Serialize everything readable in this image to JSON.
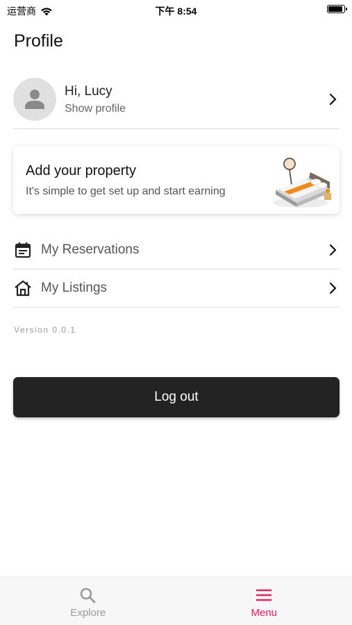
{
  "status_bar": {
    "carrier": "运营商",
    "time": "下午 8:54",
    "battery_level": 0.9
  },
  "page": {
    "title": "Profile"
  },
  "profile": {
    "greeting": "Hi, Lucy",
    "subtitle": "Show profile"
  },
  "promo": {
    "title": "Add your property",
    "subtitle": "It's simple to get set up and start earning"
  },
  "menu": [
    {
      "label": "My Reservations",
      "icon": "calendar-icon"
    },
    {
      "label": "My Listings",
      "icon": "house-icon"
    }
  ],
  "version": "Version 0.0.1",
  "logout": {
    "label": "Log out"
  },
  "tabs": [
    {
      "label": "Explore",
      "icon": "search-icon",
      "active": false
    },
    {
      "label": "Menu",
      "icon": "menu-icon",
      "active": true
    }
  ],
  "colors": {
    "accent": "#e0245e",
    "inactive_tab": "#9a9a9a",
    "button_bg": "#232323"
  }
}
